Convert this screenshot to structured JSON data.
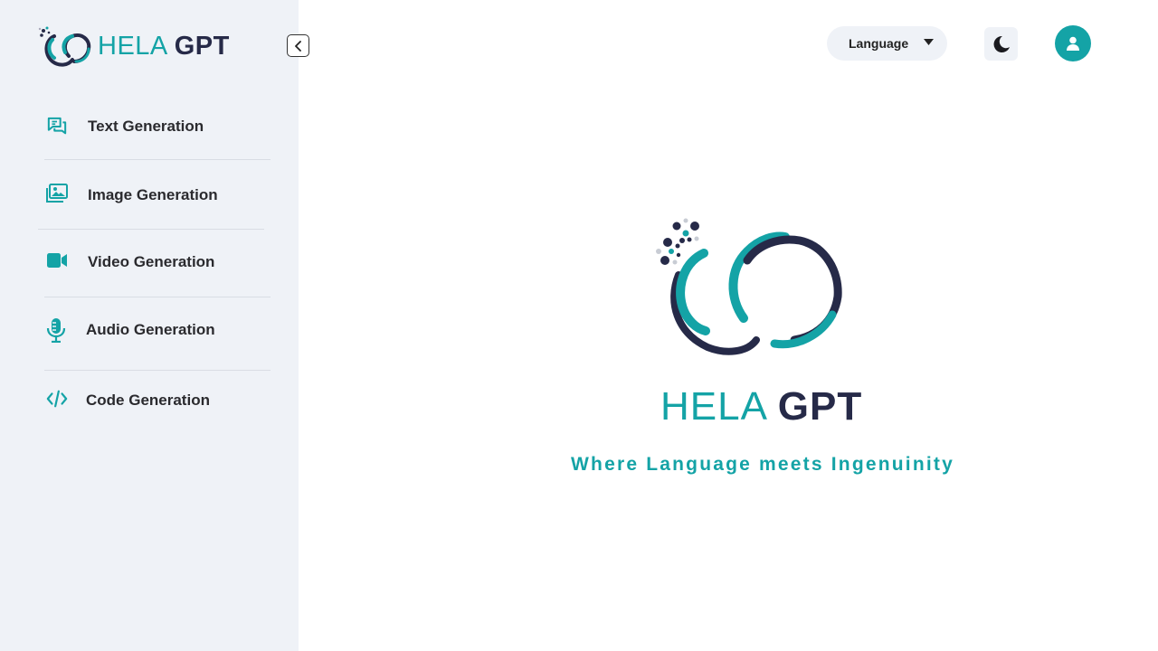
{
  "sidebar": {
    "brand": {
      "hela": "HELA",
      "gpt": "GPT"
    },
    "items": [
      {
        "label": "Text Generation",
        "icon": "chat-icon"
      },
      {
        "label": "Image Generation",
        "icon": "image-icon"
      },
      {
        "label": "Video Generation",
        "icon": "video-icon"
      },
      {
        "label": "Audio Generation",
        "icon": "microphone-icon"
      },
      {
        "label": "Code Generation",
        "icon": "code-icon"
      }
    ]
  },
  "header": {
    "language_label": "Language"
  },
  "hero": {
    "hela": "HELA",
    "gpt": "GPT",
    "tagline": "Where Language meets Ingenuinity"
  },
  "colors": {
    "accent": "#14a3a6",
    "navy": "#262a48",
    "sidebar_bg": "#eff2f7"
  }
}
